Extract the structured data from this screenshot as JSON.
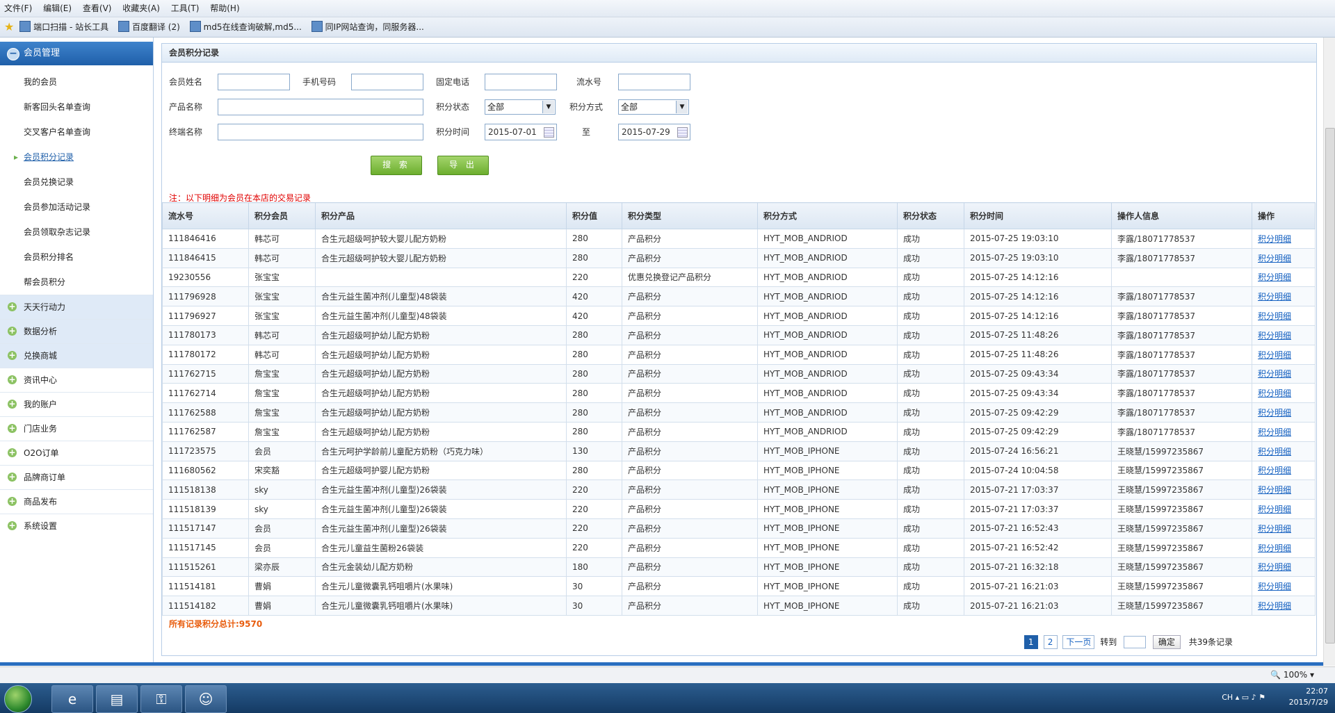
{
  "menubar": {
    "items": [
      "文件(F)",
      "编辑(E)",
      "查看(V)",
      "收藏夹(A)",
      "工具(T)",
      "帮助(H)"
    ]
  },
  "favorites": {
    "items": [
      "端口扫描 - 站长工具",
      "百度翻译 (2)",
      "md5在线查询破解,md5...",
      "同IP网站查询，同服务器..."
    ]
  },
  "sidebar": {
    "section": "会员管理",
    "subs": [
      "我的会员",
      "新客回头名单查询",
      "交叉客户名单查询",
      "会员积分记录",
      "会员兑换记录",
      "会员参加活动记录",
      "会员领取杂志记录",
      "会员积分排名",
      "帮会员积分"
    ],
    "groups": [
      "天天行动力",
      "数据分析",
      "兑换商城",
      "资讯中心",
      "我的账户",
      "门店业务",
      "O2O订单",
      "品牌商订单",
      "商品发布",
      "系统设置"
    ]
  },
  "panel": {
    "title": "会员积分记录"
  },
  "form": {
    "member_name": "会员姓名",
    "mobile": "手机号码",
    "phone": "固定电话",
    "serial": "流水号",
    "product": "产品名称",
    "status_label": "积分状态",
    "status_value": "全部",
    "method_label": "积分方式",
    "method_value": "全部",
    "terminal": "终端名称",
    "time_label": "积分时间",
    "date_from": "2015-07-01",
    "to": "至",
    "date_to": "2015-07-29",
    "search_btn": "搜 索",
    "export_btn": "导 出",
    "note": "注：以下明细为会员在本店的交易记录"
  },
  "table": {
    "headers": [
      "流水号",
      "积分会员",
      "积分产品",
      "积分值",
      "积分类型",
      "积分方式",
      "积分状态",
      "积分时间",
      "操作人信息",
      "操作"
    ],
    "rows": [
      [
        "111846416",
        "韩芯可",
        "合生元超级呵护较大婴儿配方奶粉",
        "280",
        "产品积分",
        "HYT_MOB_ANDRIOD",
        "成功",
        "2015-07-25 19:03:10",
        "李露/18071778537",
        "积分明细"
      ],
      [
        "111846415",
        "韩芯可",
        "合生元超级呵护较大婴儿配方奶粉",
        "280",
        "产品积分",
        "HYT_MOB_ANDRIOD",
        "成功",
        "2015-07-25 19:03:10",
        "李露/18071778537",
        "积分明细"
      ],
      [
        "19230556",
        "张宝宝",
        "",
        "220",
        "优惠兑换登记产品积分",
        "HYT_MOB_ANDRIOD",
        "成功",
        "2015-07-25 14:12:16",
        "",
        "积分明细"
      ],
      [
        "111796928",
        "张宝宝",
        "合生元益生菌冲剂(儿童型)48袋装",
        "420",
        "产品积分",
        "HYT_MOB_ANDRIOD",
        "成功",
        "2015-07-25 14:12:16",
        "李露/18071778537",
        "积分明细"
      ],
      [
        "111796927",
        "张宝宝",
        "合生元益生菌冲剂(儿童型)48袋装",
        "420",
        "产品积分",
        "HYT_MOB_ANDRIOD",
        "成功",
        "2015-07-25 14:12:16",
        "李露/18071778537",
        "积分明细"
      ],
      [
        "111780173",
        "韩芯可",
        "合生元超级呵护幼儿配方奶粉",
        "280",
        "产品积分",
        "HYT_MOB_ANDRIOD",
        "成功",
        "2015-07-25 11:48:26",
        "李露/18071778537",
        "积分明细"
      ],
      [
        "111780172",
        "韩芯可",
        "合生元超级呵护幼儿配方奶粉",
        "280",
        "产品积分",
        "HYT_MOB_ANDRIOD",
        "成功",
        "2015-07-25 11:48:26",
        "李露/18071778537",
        "积分明细"
      ],
      [
        "111762715",
        "詹宝宝",
        "合生元超级呵护幼儿配方奶粉",
        "280",
        "产品积分",
        "HYT_MOB_ANDRIOD",
        "成功",
        "2015-07-25 09:43:34",
        "李露/18071778537",
        "积分明细"
      ],
      [
        "111762714",
        "詹宝宝",
        "合生元超级呵护幼儿配方奶粉",
        "280",
        "产品积分",
        "HYT_MOB_ANDRIOD",
        "成功",
        "2015-07-25 09:43:34",
        "李露/18071778537",
        "积分明细"
      ],
      [
        "111762588",
        "詹宝宝",
        "合生元超级呵护幼儿配方奶粉",
        "280",
        "产品积分",
        "HYT_MOB_ANDRIOD",
        "成功",
        "2015-07-25 09:42:29",
        "李露/18071778537",
        "积分明细"
      ],
      [
        "111762587",
        "詹宝宝",
        "合生元超级呵护幼儿配方奶粉",
        "280",
        "产品积分",
        "HYT_MOB_ANDRIOD",
        "成功",
        "2015-07-25 09:42:29",
        "李露/18071778537",
        "积分明细"
      ],
      [
        "111723575",
        "会员",
        "合生元呵护学龄前儿童配方奶粉（巧克力味）",
        "130",
        "产品积分",
        "HYT_MOB_IPHONE",
        "成功",
        "2015-07-24 16:56:21",
        "王晓慧/15997235867",
        "积分明细"
      ],
      [
        "111680562",
        "宋奕豁",
        "合生元超级呵护婴儿配方奶粉",
        "280",
        "产品积分",
        "HYT_MOB_IPHONE",
        "成功",
        "2015-07-24 10:04:58",
        "王晓慧/15997235867",
        "积分明细"
      ],
      [
        "111518138",
        "sky",
        "合生元益生菌冲剂(儿童型)26袋装",
        "220",
        "产品积分",
        "HYT_MOB_IPHONE",
        "成功",
        "2015-07-21 17:03:37",
        "王晓慧/15997235867",
        "积分明细"
      ],
      [
        "111518139",
        "sky",
        "合生元益生菌冲剂(儿童型)26袋装",
        "220",
        "产品积分",
        "HYT_MOB_IPHONE",
        "成功",
        "2015-07-21 17:03:37",
        "王晓慧/15997235867",
        "积分明细"
      ],
      [
        "111517147",
        "会员",
        "合生元益生菌冲剂(儿童型)26袋装",
        "220",
        "产品积分",
        "HYT_MOB_IPHONE",
        "成功",
        "2015-07-21 16:52:43",
        "王晓慧/15997235867",
        "积分明细"
      ],
      [
        "111517145",
        "会员",
        "合生元儿童益生菌粉26袋装",
        "220",
        "产品积分",
        "HYT_MOB_IPHONE",
        "成功",
        "2015-07-21 16:52:42",
        "王晓慧/15997235867",
        "积分明细"
      ],
      [
        "111515261",
        "梁亦辰",
        "合生元金装幼儿配方奶粉",
        "180",
        "产品积分",
        "HYT_MOB_IPHONE",
        "成功",
        "2015-07-21 16:32:18",
        "王晓慧/15997235867",
        "积分明细"
      ],
      [
        "111514181",
        "曹娟",
        "合生元儿童微囊乳钙咀嚼片(水果味)",
        "30",
        "产品积分",
        "HYT_MOB_IPHONE",
        "成功",
        "2015-07-21 16:21:03",
        "王晓慧/15997235867",
        "积分明细"
      ],
      [
        "111514182",
        "曹娟",
        "合生元儿童微囊乳钙咀嚼片(水果味)",
        "30",
        "产品积分",
        "HYT_MOB_IPHONE",
        "成功",
        "2015-07-21 16:21:03",
        "王晓慧/15997235867",
        "积分明细"
      ]
    ]
  },
  "total": "所有记录积分总计:9570",
  "pager": {
    "p1": "1",
    "p2": "2",
    "next": "下一页",
    "goto": "转到",
    "ok": "确定",
    "count": "共39条记录"
  },
  "status": {
    "zoom": "100%"
  },
  "tray": {
    "lang": "CH",
    "time": "22:07",
    "date": "2015/7/29"
  }
}
